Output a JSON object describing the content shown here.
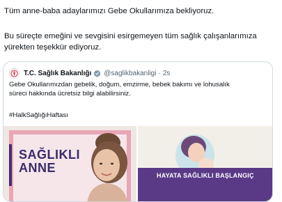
{
  "post": {
    "line1": "Tüm anne-baba adaylarımızı Gebe Okullarımıza bekliyoruz.",
    "line2": "Bu süreçte emeğini ve sevgisini esirgemeyen tüm sağlık çalışanlarımıza",
    "line3": "yürekten teşekkür ediyoruz."
  },
  "quoted": {
    "name": "T.C. Sağlık Bakanlığı",
    "handle": "@saglikbakanligi",
    "separator": "·",
    "time": "2s",
    "text_line1": "Gebe Okullarımızdan gebelik, doğum, emzirme, bebek bakımı ve lohusalık",
    "text_line2": "süreci hakkında ücretsiz bilgi alabilirsiniz.",
    "hashtag": "#HalkSağlığıHaftası",
    "logo_icon": "ministry-logo-icon",
    "verified_icon": "verified-badge-icon",
    "verified_color": "#829aab"
  },
  "images": {
    "left_title_line1": "SAĞLIKLI",
    "left_title_line2": "ANNE",
    "right_banner": "HAYATA SAĞLIKLI BAŞLANGIÇ"
  }
}
